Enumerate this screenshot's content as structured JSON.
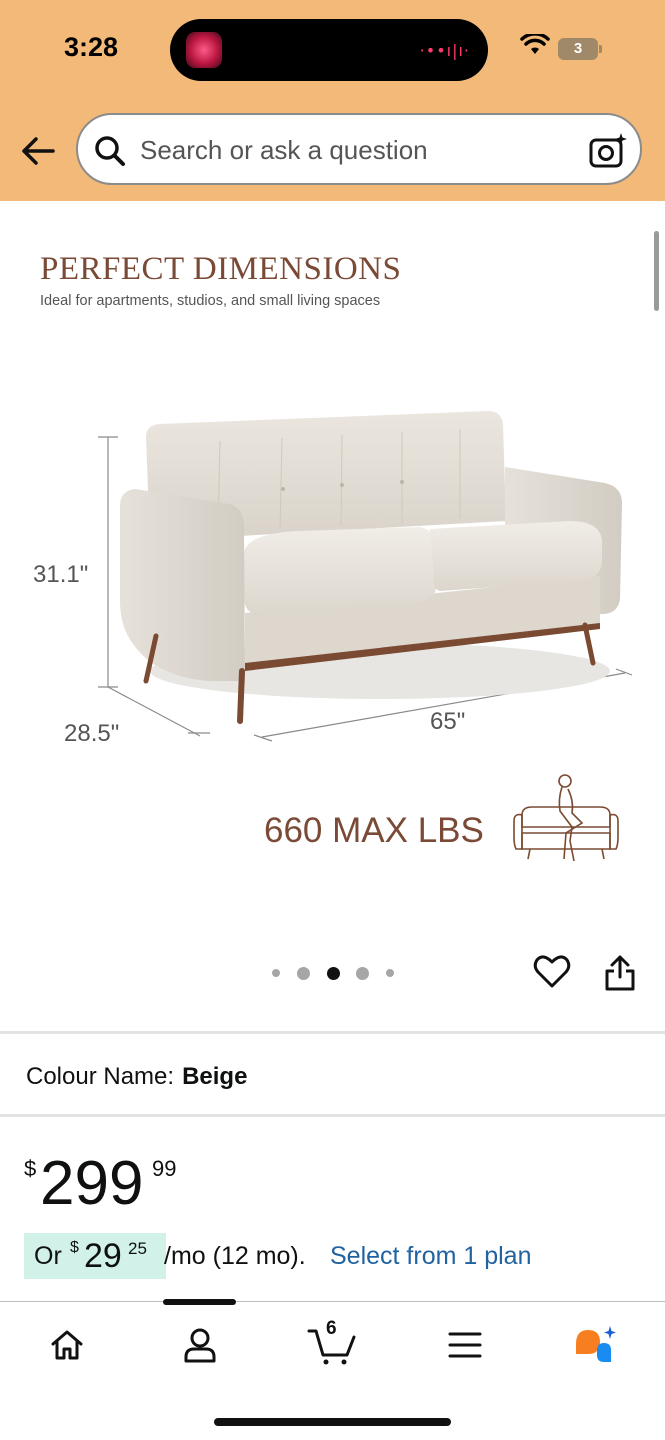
{
  "status_bar": {
    "time": "3:28",
    "battery": "3"
  },
  "search": {
    "placeholder": "Search or ask a question"
  },
  "product_image": {
    "title": "PERFECT DIMENSIONS",
    "subtitle": "Ideal for apartments, studios, and small living spaces",
    "height_label": "31.1\"",
    "depth_label": "28.5\"",
    "width_label": "65\"",
    "capacity_label": "660 MAX LBS",
    "carousel": {
      "count": 5,
      "active_index": 2
    }
  },
  "colour": {
    "label": "Colour Name:",
    "value": "Beige"
  },
  "price": {
    "symbol": "$",
    "whole": "299",
    "fraction": "99"
  },
  "installment": {
    "prefix": "Or",
    "symbol": "$",
    "whole": "29",
    "fraction": "25",
    "suffix": "/mo (12 mo).",
    "link": "Select from 1 plan"
  },
  "bottom_nav": {
    "cart_count": "6",
    "items": [
      "home-icon",
      "account-icon",
      "cart-icon",
      "menu-icon",
      "rufus-icon"
    ]
  },
  "colors": {
    "header": "#f3b979",
    "link": "#2162a1",
    "highlight": "#d2f2e9",
    "title_brown": "#7a4a36"
  }
}
